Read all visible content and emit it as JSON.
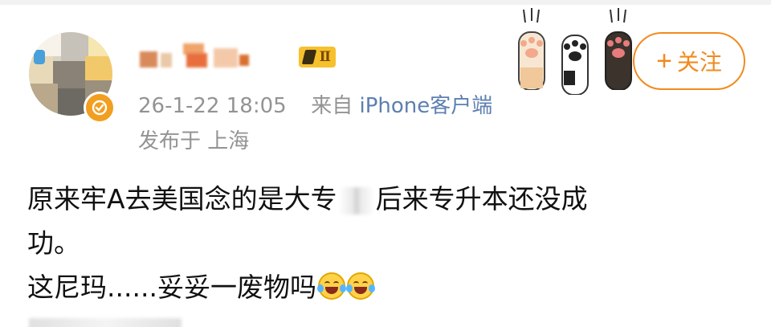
{
  "post": {
    "username": "",
    "level_badge": "Ⅱ",
    "timestamp": "26-1-22 18:05",
    "source_prefix": "来自",
    "source": "iPhone客户端",
    "location": "发布于 上海",
    "follow_label": "关注",
    "follow_plus": "+",
    "body": {
      "line1_a": "原来牢A去美国念的是大专",
      "line1_b": "后来专升本还没成",
      "line2": "功。",
      "line3": "这尼玛......妥妥一废物吗"
    },
    "emoji_count": 2
  },
  "icons": {
    "avatar": "avatar",
    "verified": "verified-badge-icon",
    "paws": "cat-paw-decoration-icon",
    "emoji": "laughing-crying-emoji-icon"
  },
  "colors": {
    "accent": "#f28a1e",
    "meta_text": "#939393",
    "source_link": "#5d7fb0",
    "verified": "#f29e1f"
  }
}
